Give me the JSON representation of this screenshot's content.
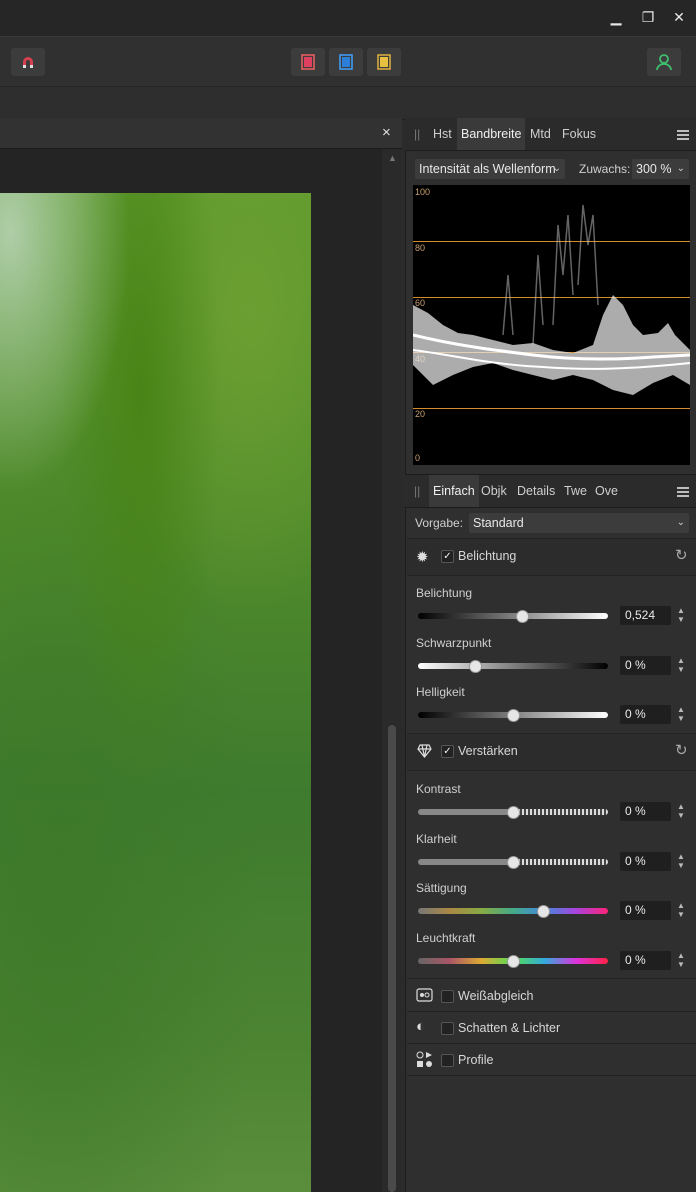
{
  "window": {
    "minimize_label": "▁",
    "restore_label": "❐",
    "close_label": "✕"
  },
  "document": {
    "close_label": "×"
  },
  "scope_panel": {
    "tabs": [
      "Hst",
      "Bandbreite",
      "Mtd",
      "Fokus"
    ],
    "active_tab": "Bandbreite",
    "mode_value": "Intensität als Wellenform",
    "zoom_label": "Zuwachs:",
    "zoom_value": "300 %",
    "axis": [
      "100",
      "80",
      "60",
      "40",
      "20",
      "0"
    ]
  },
  "adjust_panel": {
    "tabs": [
      "Einfach",
      "Objk",
      "Details",
      "Twe",
      "Ove"
    ],
    "active_tab": "Einfach",
    "preset_label": "Vorgabe:",
    "preset_value": "Standard",
    "sections": {
      "exposure": {
        "title": "Belichtung",
        "checked": true,
        "sliders": [
          {
            "label": "Belichtung",
            "value": "0,524",
            "fraction": 0.545
          },
          {
            "label": "Schwarzpunkt",
            "value": "0 %",
            "fraction": 0.3
          },
          {
            "label": "Helligkeit",
            "value": "0 %",
            "fraction": 0.5
          }
        ]
      },
      "enhance": {
        "title": "Verstärken",
        "checked": true,
        "sliders": [
          {
            "label": "Kontrast",
            "value": "0 %",
            "fraction": 0.5
          },
          {
            "label": "Klarheit",
            "value": "0 %",
            "fraction": 0.5
          },
          {
            "label": "Sättigung",
            "value": "0 %",
            "fraction": 0.655
          },
          {
            "label": "Leuchtkraft",
            "value": "0 %",
            "fraction": 0.5
          }
        ]
      },
      "white_balance": {
        "title": "Weißabgleich",
        "checked": false
      },
      "shadows": {
        "title": "Schatten & Lichter",
        "checked": false
      },
      "profiles": {
        "title": "Profile",
        "checked": false
      }
    }
  },
  "colors": {
    "accent_orange": "#d48c2c",
    "user_icon_green": "#3fbf6f",
    "panel_bg": "#2f2f2f"
  }
}
